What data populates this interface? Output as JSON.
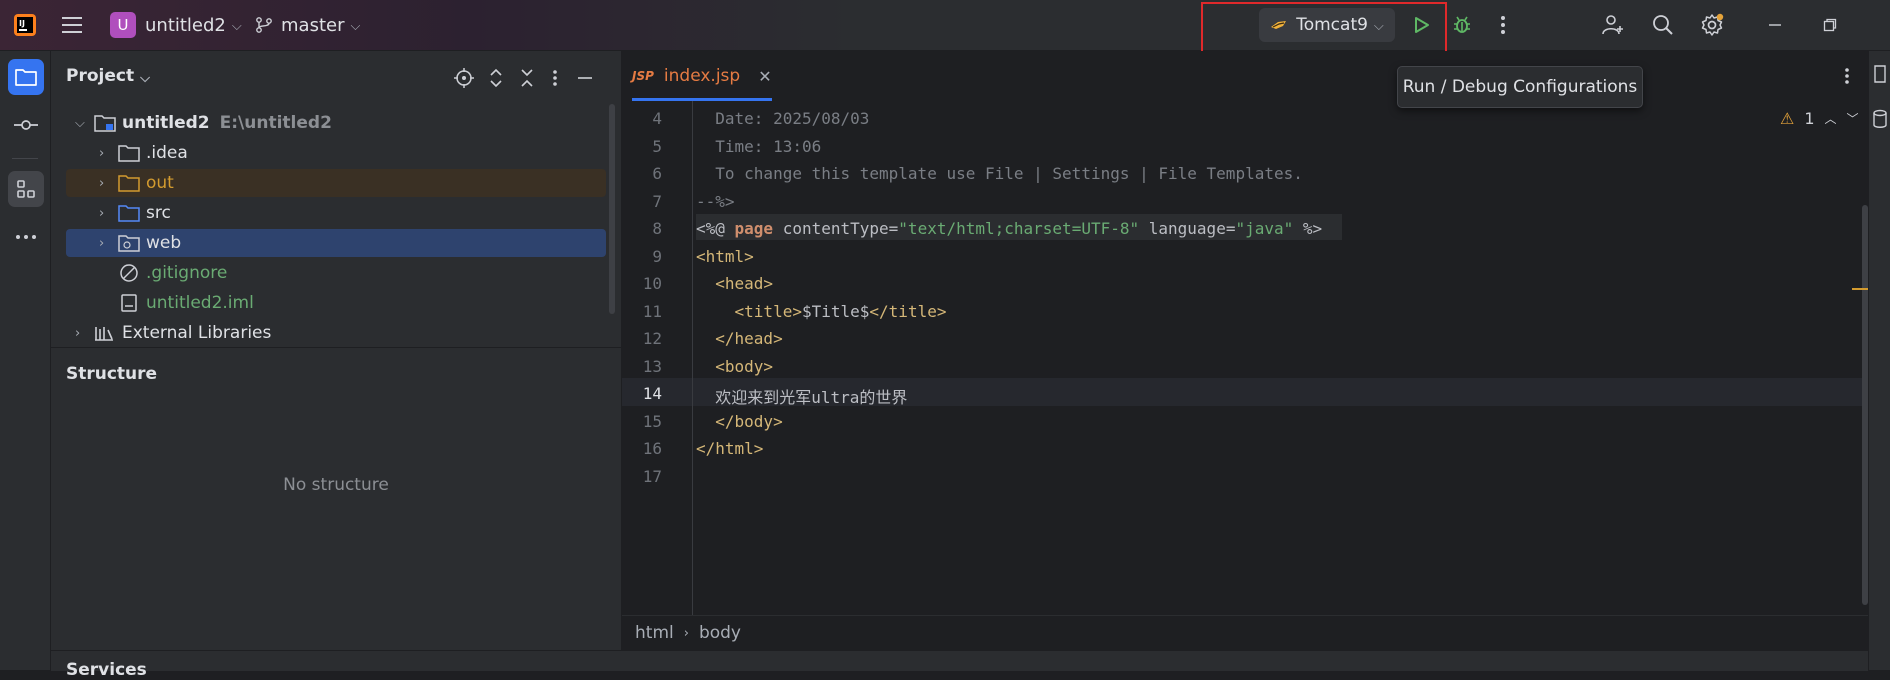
{
  "titlebar": {
    "project_initial": "U",
    "project_name": "untitled2",
    "branch": "master",
    "run_config": "Tomcat9"
  },
  "tooltip": {
    "text": "Run / Debug Configurations"
  },
  "project_panel": {
    "title": "Project",
    "tree": [
      {
        "label": "untitled2",
        "path": "E:\\untitled2",
        "type": "module",
        "expanded": true
      },
      {
        "label": ".idea",
        "type": "folder"
      },
      {
        "label": "out",
        "type": "folder-excluded"
      },
      {
        "label": "src",
        "type": "source-folder"
      },
      {
        "label": "web",
        "type": "web-folder",
        "selected": true
      },
      {
        "label": ".gitignore",
        "type": "ignore-file"
      },
      {
        "label": "untitled2.iml",
        "type": "iml-file"
      },
      {
        "label": "External Libraries",
        "type": "libraries"
      }
    ]
  },
  "structure_panel": {
    "title": "Structure",
    "empty_text": "No structure"
  },
  "editor": {
    "tab_badge": "JSP",
    "tab_label": "index.jsp",
    "warning_count": "1",
    "line_numbers": [
      "4",
      "5",
      "6",
      "7",
      "8",
      "9",
      "10",
      "11",
      "12",
      "13",
      "14",
      "15",
      "16",
      "17"
    ],
    "code": {
      "l4": "  Date: 2025/08/03",
      "l5": "  Time: 13:06",
      "l6": "  To change this template use File | Settings | File Templates.",
      "l7": "--%>",
      "l8_a": "<%@ ",
      "l8_kw": "page",
      "l8_b": " contentType=",
      "l8_s1": "\"text/html;charset=UTF-8\"",
      "l8_c": " language=",
      "l8_s2": "\"java\"",
      "l8_d": " %>",
      "l9": "<html>",
      "l10": "  <head>",
      "l11_a": "    <title>",
      "l11_b": "$Title$",
      "l11_c": "</title>",
      "l12": "  </head>",
      "l13": "  <body>",
      "l14": "  欢迎来到光军ultra的世界",
      "l15": "  </body>",
      "l16": "</html>"
    }
  },
  "breadcrumbs": [
    "html",
    "body"
  ],
  "bottom_panel": {
    "label": "Services"
  },
  "colors": {
    "accent": "#3574f0",
    "highlight_box": "#e0292b",
    "run_green": "#5fb865",
    "excluded_orange": "#d39b2f",
    "vcs_green": "#6aab73"
  }
}
